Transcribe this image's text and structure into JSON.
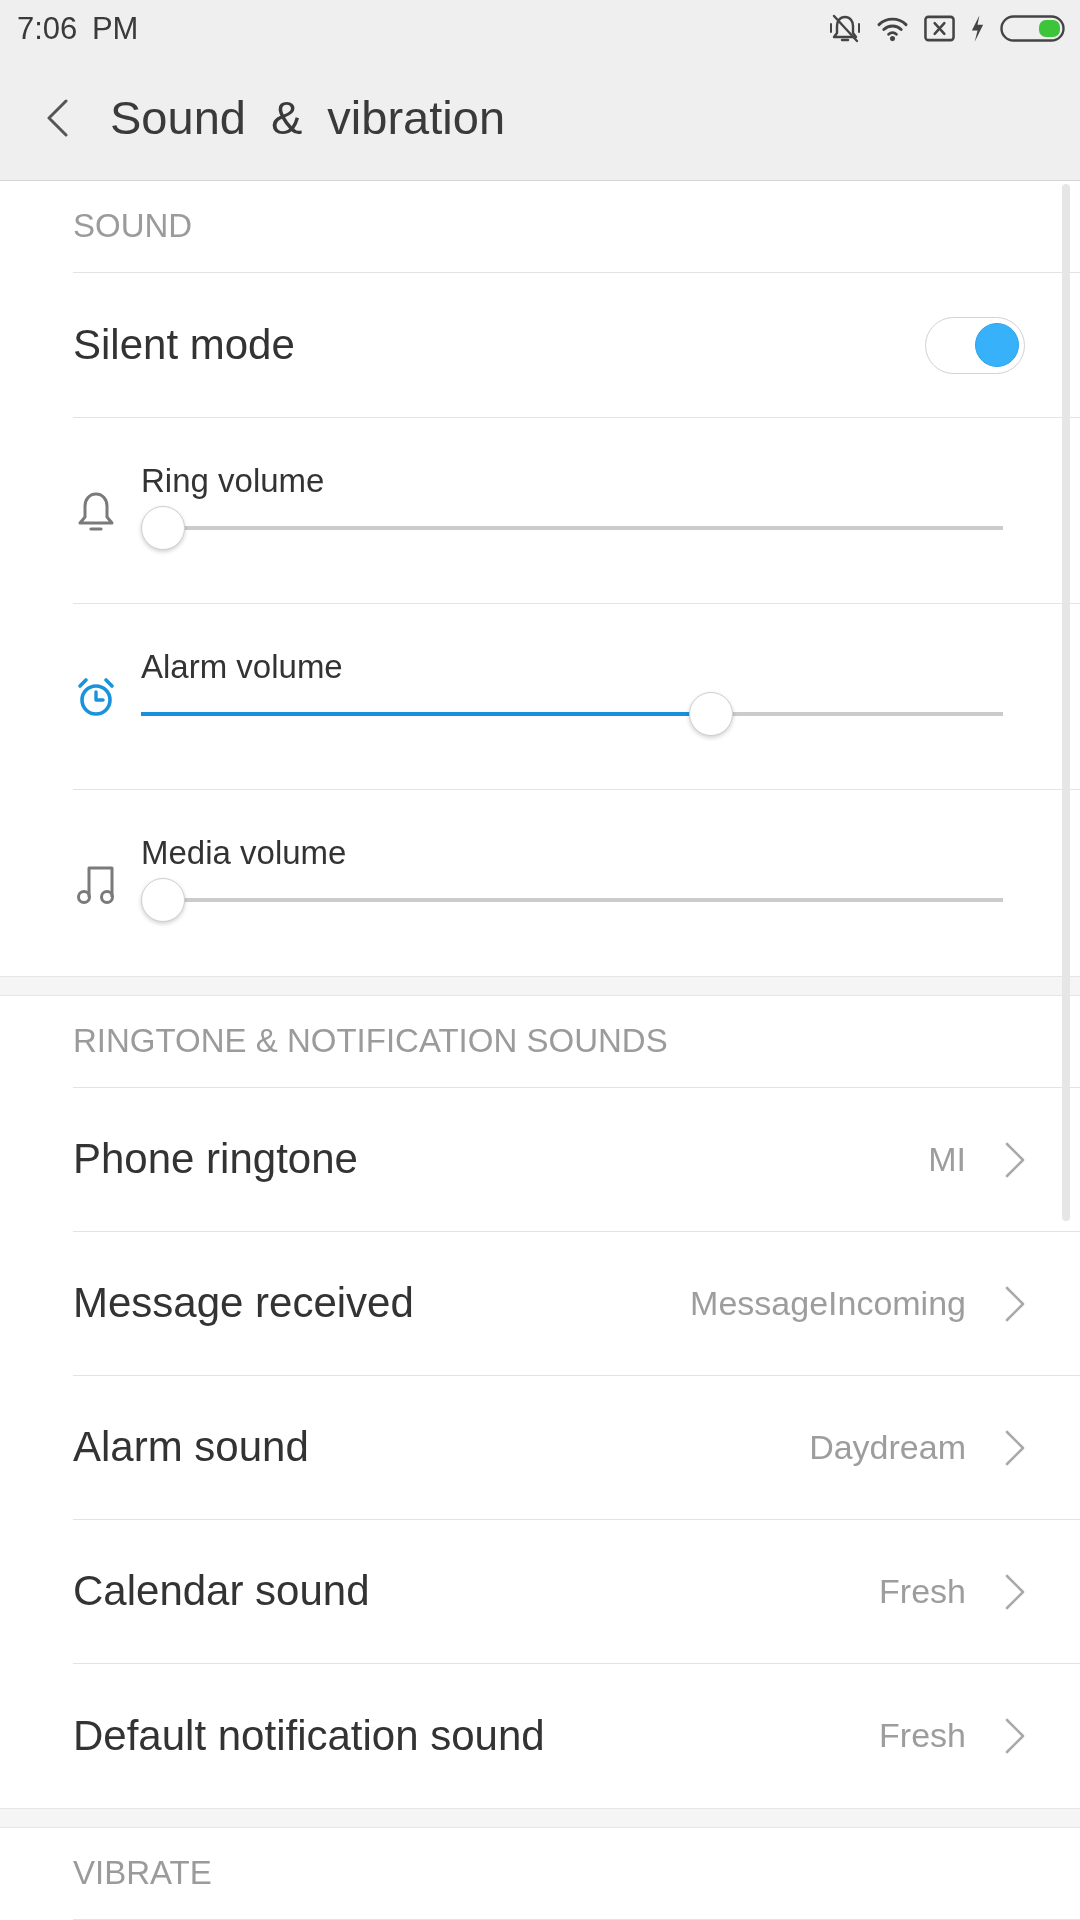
{
  "status_bar": {
    "time": "7:06 PM"
  },
  "header": {
    "title": "Sound & vibration"
  },
  "sections": [
    {
      "title": "SOUND",
      "items": [
        {
          "kind": "toggle",
          "label": "Silent mode",
          "on": true
        },
        {
          "kind": "slider",
          "label": "Ring volume",
          "level": 0
        },
        {
          "kind": "slider",
          "label": "Alarm volume",
          "level": 0.67
        },
        {
          "kind": "slider",
          "label": "Media volume",
          "level": 0
        }
      ]
    },
    {
      "title": "RINGTONE & NOTIFICATION SOUNDS",
      "items": [
        {
          "kind": "link",
          "label": "Phone ringtone",
          "value": "MI"
        },
        {
          "kind": "link",
          "label": "Message received",
          "value": "MessageIncoming"
        },
        {
          "kind": "link",
          "label": "Alarm sound",
          "value": "Daydream"
        },
        {
          "kind": "link",
          "label": "Calendar sound",
          "value": "Fresh"
        },
        {
          "kind": "link",
          "label": "Default notification sound",
          "value": "Fresh"
        }
      ]
    },
    {
      "title": "VIBRATE"
    }
  ]
}
